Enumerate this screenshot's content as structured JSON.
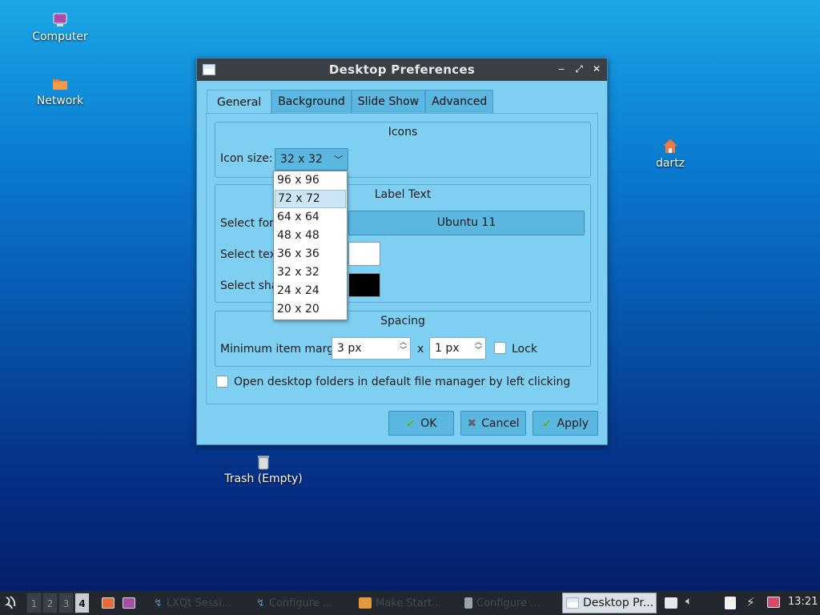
{
  "desktop": {
    "icons": [
      {
        "label": "Computer",
        "icon": "computer-icon"
      },
      {
        "label": "Network",
        "icon": "folder-icon"
      },
      {
        "label": "dartz",
        "icon": "home-icon"
      },
      {
        "label": "Trash (Empty)",
        "icon": "trash-icon"
      }
    ]
  },
  "window": {
    "title": "Desktop Preferences",
    "controls": {
      "minimize": "‒",
      "maximize": "⤢",
      "close": "✕"
    },
    "tabs": [
      {
        "label": "General",
        "active": true
      },
      {
        "label": "Background",
        "active": false
      },
      {
        "label": "Slide Show",
        "active": false
      },
      {
        "label": "Advanced",
        "active": false
      }
    ],
    "icons_group": {
      "title": "Icons",
      "icon_size_label": "Icon size:",
      "icon_size_value": "32 x 32",
      "options": [
        "96 x 96",
        "72 x 72",
        "64 x 64",
        "48 x 48",
        "36 x 36",
        "32 x 32",
        "24 x 24",
        "20 x 20"
      ],
      "highlighted_option": "72 x 72"
    },
    "label_text_group": {
      "title": "Label Text",
      "select_font_label": "Select fon",
      "font_value": "Ubuntu 11",
      "select_text_color_label": "Select tex",
      "select_shadow_color_label": "Select sha",
      "text_color": "#ffffff",
      "shadow_color": "#000000"
    },
    "spacing_group": {
      "title": "Spacing",
      "margins_label": "Minimum item margins:",
      "x_value": "3 px",
      "separator": "x",
      "y_value": "1 px",
      "lock_label": "Lock",
      "lock_checked": false
    },
    "open_folders_label": "Open desktop folders in default file manager by left clicking",
    "open_folders_checked": false,
    "buttons": {
      "ok": "OK",
      "cancel": "Cancel",
      "apply": "Apply"
    }
  },
  "taskbar": {
    "workspaces": [
      "1",
      "2",
      "3",
      "4"
    ],
    "active_workspace": "4",
    "apps": [
      {
        "label": "LXQt Sessi..."
      },
      {
        "label": "Configure ..."
      },
      {
        "label": "Make Start..."
      },
      {
        "label": "Configure ..."
      }
    ],
    "active_app": "Desktop Pr...",
    "clock": "13:21"
  }
}
